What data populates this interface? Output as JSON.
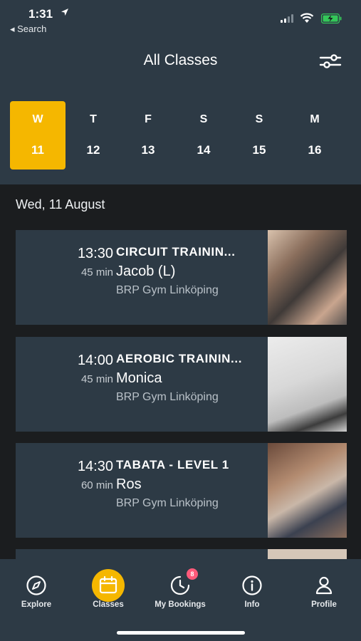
{
  "status": {
    "time": "1:31",
    "back_label": "◂ Search"
  },
  "header": {
    "title": "All Classes"
  },
  "days": [
    {
      "letter": "W",
      "num": "11",
      "active": true
    },
    {
      "letter": "T",
      "num": "12",
      "active": false
    },
    {
      "letter": "F",
      "num": "13",
      "active": false
    },
    {
      "letter": "S",
      "num": "14",
      "active": false
    },
    {
      "letter": "S",
      "num": "15",
      "active": false
    },
    {
      "letter": "M",
      "num": "16",
      "active": false
    }
  ],
  "date_heading": "Wed, 11 August",
  "classes": [
    {
      "time": "13:30",
      "duration": "45 min",
      "title": "CIRCUIT TRAININ...",
      "instructor": "Jacob (L)",
      "location": "BRP Gym Linköping"
    },
    {
      "time": "14:00",
      "duration": "45 min",
      "title": "AEROBIC TRAININ...",
      "instructor": "Monica",
      "location": "BRP Gym Linköping"
    },
    {
      "time": "14:30",
      "duration": "60 min",
      "title": "TABATA - LEVEL 1",
      "instructor": "Ros",
      "location": "BRP Gym Linköping"
    }
  ],
  "tabs": [
    {
      "label": "Explore",
      "icon": "compass-icon"
    },
    {
      "label": "Classes",
      "icon": "calendar-icon"
    },
    {
      "label": "My Bookings",
      "icon": "clock-icon"
    },
    {
      "label": "Info",
      "icon": "info-icon"
    },
    {
      "label": "Profile",
      "icon": "person-icon"
    }
  ],
  "bookings_badge": "8",
  "colors": {
    "accent": "#f5b700",
    "panel": "#2d3a45",
    "background": "#1b1d1f",
    "badge": "#ff5a7a"
  }
}
